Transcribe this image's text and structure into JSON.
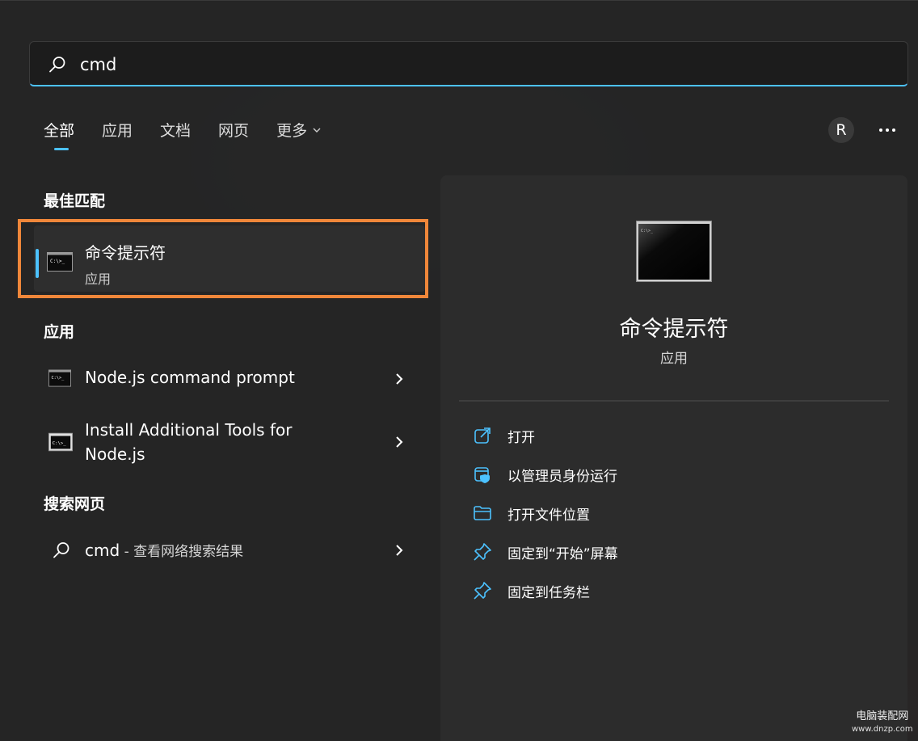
{
  "search": {
    "query": "cmd"
  },
  "tabs": [
    {
      "label": "全部"
    },
    {
      "label": "应用"
    },
    {
      "label": "文档"
    },
    {
      "label": "网页"
    },
    {
      "label": "更多"
    }
  ],
  "user": {
    "avatar_letter": "R"
  },
  "sections": {
    "best_match": "最佳匹配",
    "apps": "应用",
    "web": "搜索网页"
  },
  "best_match": {
    "title": "命令提示符",
    "subtitle": "应用"
  },
  "apps": [
    {
      "title": "Node.js command prompt"
    },
    {
      "title_line1": "Install Additional Tools for",
      "title_line2": "Node.js"
    }
  ],
  "web_result": {
    "query": "cmd",
    "suffix": " - 查看网络搜索结果"
  },
  "detail": {
    "title": "命令提示符",
    "subtitle": "应用",
    "actions": [
      {
        "label": "打开",
        "icon": "open-external-icon"
      },
      {
        "label": "以管理员身份运行",
        "icon": "run-as-admin-icon"
      },
      {
        "label": "打开文件位置",
        "icon": "folder-icon"
      },
      {
        "label": "固定到“开始”屏幕",
        "icon": "pin-icon"
      },
      {
        "label": "固定到任务栏",
        "icon": "pin-icon"
      }
    ]
  },
  "watermark": {
    "line1": "电脑装配网",
    "line2": "www.dnzp.com"
  },
  "colors": {
    "accent": "#4cc2ff",
    "highlight": "#f0873a"
  }
}
